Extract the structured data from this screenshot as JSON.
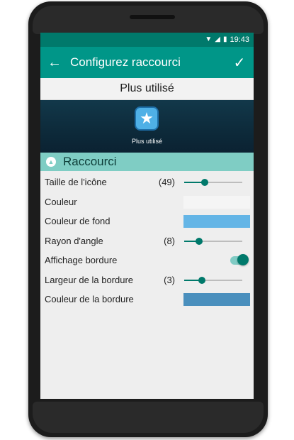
{
  "statusbar": {
    "time": "19:43",
    "wifi_icon": "wifi-icon",
    "signal_icon": "signal-icon",
    "battery_icon": "battery-icon"
  },
  "appbar": {
    "title": "Configurez raccourci",
    "back_icon": "arrow-back-icon",
    "confirm_icon": "check-icon"
  },
  "preview": {
    "title": "Plus utilisé",
    "shortcut_label": "Plus utilisé",
    "icon": "star-icon"
  },
  "section": {
    "title": "Raccourci",
    "collapse_icon": "chevron-up-icon"
  },
  "settings": {
    "icon_size": {
      "label": "Taille de l'icône",
      "value": "(49)",
      "level": 0.35
    },
    "color": {
      "label": "Couleur",
      "swatch": "#f5f5f5"
    },
    "background_color": {
      "label": "Couleur de fond",
      "swatch": "#64b5e6"
    },
    "corner_radius": {
      "label": "Rayon d'angle",
      "value": "(8)",
      "level": 0.25
    },
    "border_display": {
      "label": "Affichage bordure",
      "enabled": true
    },
    "border_width": {
      "label": "Largeur de la bordure",
      "value": "(3)",
      "level": 0.3
    },
    "border_color": {
      "label": "Couleur de la bordure",
      "swatch": "#4a8fbd"
    }
  },
  "colors": {
    "primary": "#009688",
    "primary_dark": "#00796b",
    "section": "#7fcdc4"
  }
}
